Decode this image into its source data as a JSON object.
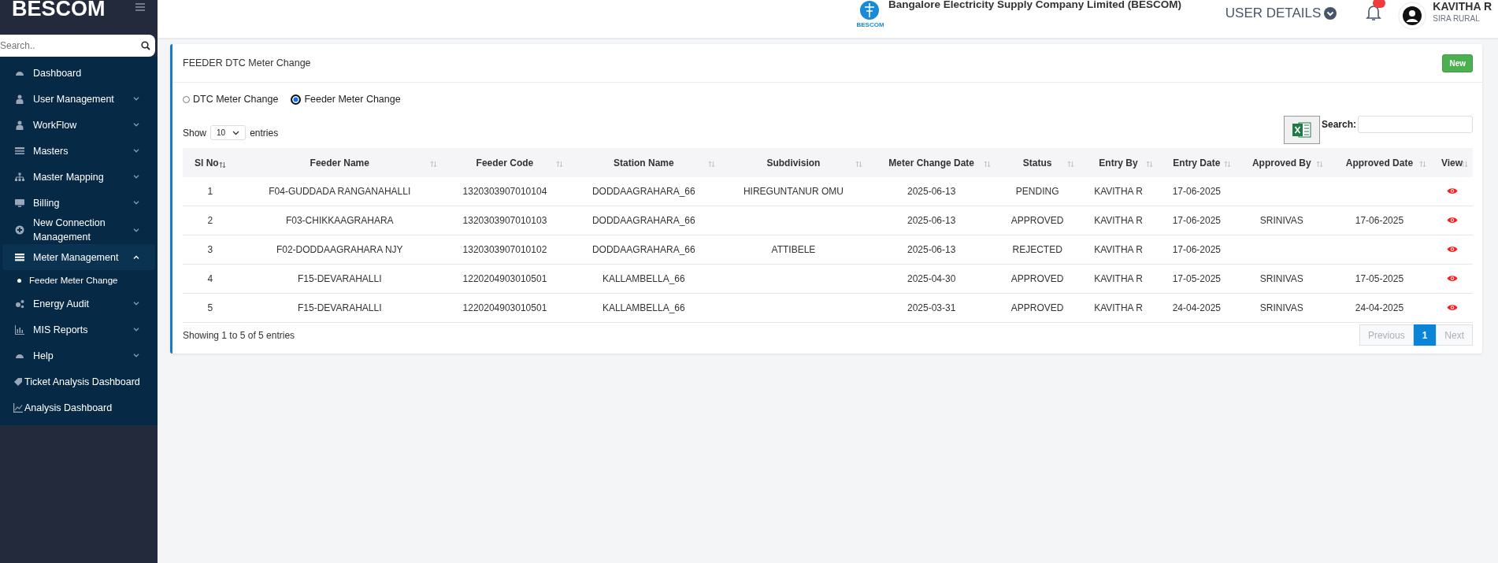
{
  "sidebar": {
    "logo": "BESCOM",
    "search": {
      "placeholder": "Search.."
    },
    "items": [
      {
        "kind": "link",
        "label": "Dashboard",
        "selected": false
      },
      {
        "kind": "group",
        "label": "User Management",
        "expanded": false,
        "selected": false
      },
      {
        "kind": "group",
        "label": "WorkFlow",
        "expanded": false,
        "selected": false
      },
      {
        "kind": "group",
        "label": "Masters",
        "expanded": false,
        "selected": false
      },
      {
        "kind": "group",
        "label": "Master Mapping",
        "expanded": false,
        "selected": false
      },
      {
        "kind": "group",
        "label": "Billing",
        "expanded": false,
        "selected": false
      },
      {
        "kind": "group",
        "label": "New Connection Management",
        "expanded": false,
        "selected": false
      },
      {
        "kind": "group",
        "label": "Meter Management",
        "expanded": true,
        "selected": true,
        "children": [
          {
            "label": "Feeder Meter Change"
          }
        ]
      },
      {
        "kind": "group",
        "label": "Energy Audit",
        "expanded": false,
        "selected": false
      },
      {
        "kind": "group",
        "label": "MIS Reports",
        "expanded": false,
        "selected": false
      },
      {
        "kind": "group",
        "label": "Help",
        "expanded": false,
        "selected": false
      },
      {
        "kind": "plain",
        "label": "Ticket Analysis Dashboard",
        "selected": false
      },
      {
        "kind": "plain",
        "label": "Analysis Dashboard",
        "selected": false
      }
    ]
  },
  "header": {
    "company": "Bangalore Electricity Supply Company Limited (BESCOM)",
    "logo_caption": "BESCOM",
    "user_details": "USER DETAILS",
    "user_name": "KAVITHA R",
    "user_location": "SIRA RURAL"
  },
  "card": {
    "title": "FEEDER DTC Meter Change",
    "new_button": "New",
    "radios": [
      {
        "label": "DTC Meter Change",
        "selected": false
      },
      {
        "label": "Feeder Meter Change",
        "selected": true
      }
    ],
    "show_label": "Show",
    "page_size": "10",
    "entries_label": "entries",
    "search_label": "Search:",
    "table": {
      "columns": [
        "Sl No",
        "Feeder Name",
        "Feeder Code",
        "Station Name",
        "Subdivision",
        "Meter Change Date",
        "Status",
        "Entry By",
        "Entry Date",
        "Approved By",
        "Approved Date",
        "View"
      ],
      "rows": [
        [
          "1",
          "F04-GUDDADA RANGANAHALLI",
          "1320303907010104",
          "DODDAAGRAHARA_66",
          "HIREGUNTANUR OMU",
          "2025-06-13",
          "PENDING",
          "KAVITHA R",
          "17-06-2025",
          "",
          ""
        ],
        [
          "2",
          "F03-CHIKKAAGRAHARA",
          "1320303907010103",
          "DODDAAGRAHARA_66",
          "",
          "2025-06-13",
          "APPROVED",
          "KAVITHA R",
          "17-06-2025",
          "SRINIVAS",
          "17-06-2025"
        ],
        [
          "3",
          "F02-DODDAAGRAHARA NJY",
          "1320303907010102",
          "DODDAAGRAHARA_66",
          "ATTIBELE",
          "2025-06-13",
          "REJECTED",
          "KAVITHA R",
          "17-06-2025",
          "",
          ""
        ],
        [
          "4",
          "F15-DEVARAHALLI",
          "1220204903010501",
          "KALLAMBELLA_66",
          "",
          "2025-04-30",
          "APPROVED",
          "KAVITHA R",
          "17-05-2025",
          "SRINIVAS",
          "17-05-2025"
        ],
        [
          "5",
          "F15-DEVARAHALLI",
          "1220204903010501",
          "KALLAMBELLA_66",
          "",
          "2025-03-31",
          "APPROVED",
          "KAVITHA R",
          "24-04-2025",
          "SRINIVAS",
          "24-04-2025"
        ]
      ]
    },
    "info": "Showing 1 to 5 of 5 entries",
    "pagination": [
      {
        "label": "Previous",
        "disabled": true,
        "selected": false
      },
      {
        "label": "1",
        "disabled": false,
        "selected": true
      },
      {
        "label": "Next",
        "disabled": true,
        "selected": false
      }
    ]
  }
}
